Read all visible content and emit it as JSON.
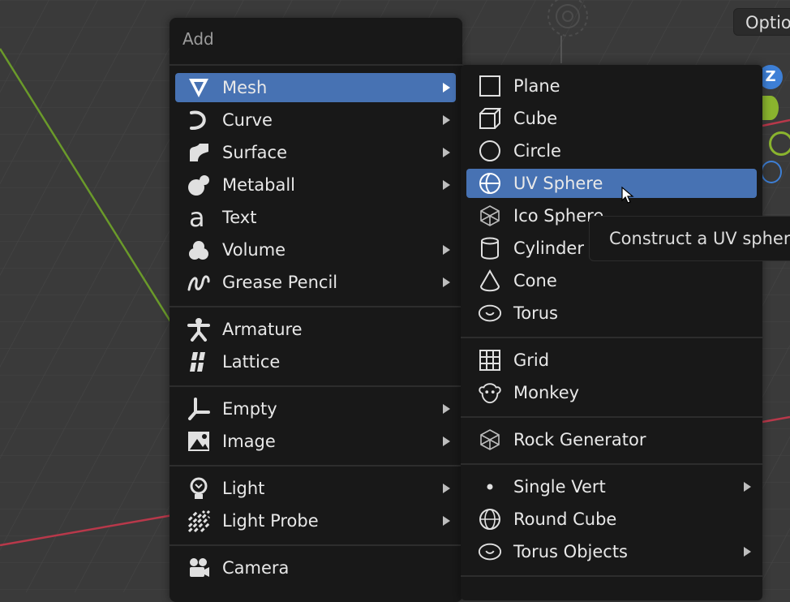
{
  "options_button": {
    "label": "Optio"
  },
  "axis_gizmo": {
    "z_label": "Z"
  },
  "add_menu": {
    "title": "Add",
    "items": [
      {
        "label": "Mesh",
        "icon": "mesh-icon",
        "submenu": true,
        "active": true
      },
      {
        "label": "Curve",
        "icon": "curve-icon",
        "submenu": true
      },
      {
        "label": "Surface",
        "icon": "surface-icon",
        "submenu": true
      },
      {
        "label": "Metaball",
        "icon": "metaball-icon",
        "submenu": true
      },
      {
        "label": "Text",
        "icon": "text-icon",
        "submenu": false
      },
      {
        "label": "Volume",
        "icon": "volume-icon",
        "submenu": true
      },
      {
        "label": "Grease Pencil",
        "icon": "grease-pencil-icon",
        "submenu": true
      },
      {
        "label": "Armature",
        "icon": "armature-icon",
        "submenu": false
      },
      {
        "label": "Lattice",
        "icon": "lattice-icon",
        "submenu": false
      },
      {
        "label": "Empty",
        "icon": "empty-icon",
        "submenu": true
      },
      {
        "label": "Image",
        "icon": "image-icon",
        "submenu": true
      },
      {
        "label": "Light",
        "icon": "light-icon",
        "submenu": true
      },
      {
        "label": "Light Probe",
        "icon": "light-probe-icon",
        "submenu": true
      },
      {
        "label": "Camera",
        "icon": "camera-icon",
        "submenu": false
      }
    ]
  },
  "mesh_menu": {
    "items": [
      {
        "label": "Plane",
        "icon": "plane-icon"
      },
      {
        "label": "Cube",
        "icon": "cube-icon"
      },
      {
        "label": "Circle",
        "icon": "circle-icon"
      },
      {
        "label": "UV Sphere",
        "icon": "uv-sphere-icon",
        "active": true
      },
      {
        "label": "Ico Sphere",
        "icon": "ico-sphere-icon"
      },
      {
        "label": "Cylinder",
        "icon": "cylinder-icon"
      },
      {
        "label": "Cone",
        "icon": "cone-icon"
      },
      {
        "label": "Torus",
        "icon": "torus-icon"
      },
      {
        "label": "Grid",
        "icon": "grid-icon"
      },
      {
        "label": "Monkey",
        "icon": "monkey-icon"
      },
      {
        "label": "Rock Generator",
        "icon": "rock-generator-icon"
      },
      {
        "label": "Single Vert",
        "icon": "single-vert-icon",
        "submenu": true
      },
      {
        "label": "Round Cube",
        "icon": "round-cube-icon"
      },
      {
        "label": "Torus Objects",
        "icon": "torus-objects-icon",
        "submenu": true
      }
    ]
  },
  "tooltip": {
    "text": "Construct a UV spher"
  },
  "colors": {
    "menu_bg": "#181818",
    "highlight": "#4772b3",
    "viewport_bg": "#3a3a3a",
    "x_axis": "#b8384a",
    "y_axis": "#6a9a2a",
    "z_gizmo": "#3d7fd6",
    "y_gizmo": "#8ab42e"
  }
}
